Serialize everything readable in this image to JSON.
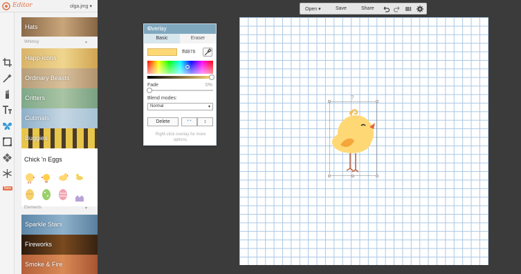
{
  "app": {
    "logo_text": "Editor",
    "filename": "olga.jmg",
    "filename_arrow": "▾",
    "new_badge": "New"
  },
  "sidebar": {
    "top_item": "Hats",
    "section_whimsy": "Whimsy",
    "whimsy_items": [
      "Happ-icons",
      "Ordinary Beasts",
      "Critters",
      "Cutimals",
      "Buggies"
    ],
    "expanded_item": "Chick 'n Eggs",
    "section_elements": "Elements",
    "elements_items": [
      "Sparkle Stars",
      "Fireworks",
      "Smoke & Fire"
    ],
    "section_arrow": "▾"
  },
  "toolbar": {
    "open": "Open",
    "save": "Save",
    "share": "Share",
    "open_arrow": "▾"
  },
  "overlay": {
    "title": "Overlay",
    "close": "×",
    "tab_basic": "Basic",
    "tab_eraser": "Eraser",
    "color_hex": "ffd876",
    "color": "#ffd876",
    "fade_label": "Fade",
    "fade_value": "0%",
    "blend_label": "Blend modes:",
    "blend_value": "Normal",
    "blend_arrow": "▾",
    "delete_label": "Delete",
    "order_front": "⁺⁺",
    "order_flip": "↕",
    "hint": "Right-click overlay for more options."
  },
  "canvas": {
    "rotate_glyph": "?"
  },
  "colors": {
    "accent": "#e2744a",
    "title_bar": "#7fa8bf",
    "grid": "#a9c7e4",
    "chick_body": "#ffd876",
    "chick_wing": "#f4a63a",
    "beak": "#e8603c"
  }
}
